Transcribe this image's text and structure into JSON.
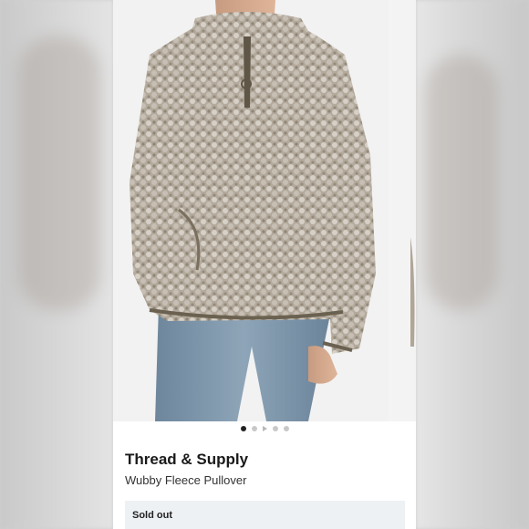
{
  "product": {
    "brand": "Thread & Supply",
    "name": "Wubby Fleece Pullover",
    "availability": "Sold out"
  },
  "carousel": {
    "slide_count": 5,
    "active_index": 0,
    "video_indicator_index": 2
  },
  "colors": {
    "fleece": "#a89e91",
    "jeans": "#7f97ac",
    "trim": "#6b6150"
  }
}
